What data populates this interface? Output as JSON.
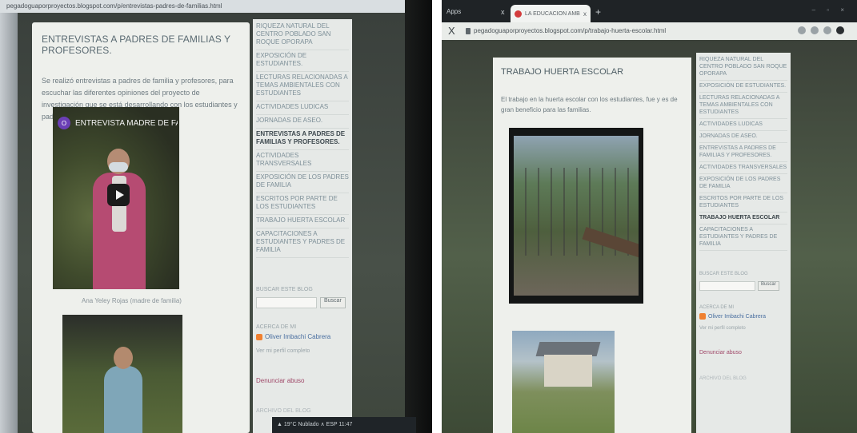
{
  "left": {
    "url": "pegadoguaporproyectos.blogspot.com/p/entrevistas-padres-de-familias.html",
    "post": {
      "title": "ENTREVISTAS A PADRES DE FAMILIAS Y PROFESORES.",
      "body": "Se realizó entrevistas a padres de familia y profesores, para escuchar las diferentes opiniones del proyecto de investigación que se está desarrollando con los estudiantes y padres de familia.",
      "video_avatar": "O",
      "video_title": "ENTREVISTA MADRE DE FA...",
      "caption": "Ana Yeley Rojas (madre de familia)"
    },
    "sidebar": {
      "nav": [
        {
          "label": "RIQUEZA NATURAL DEL CENTRO POBLADO SAN ROQUE OPORAPA",
          "active": false
        },
        {
          "label": "EXPOSICIÓN DE ESTUDIANTES.",
          "active": false
        },
        {
          "label": "LECTURAS RELACIONADAS A TEMAS AMBIENTALES CON ESTUDIANTES",
          "active": false
        },
        {
          "label": "ACTIVIDADES LUDICAS",
          "active": false
        },
        {
          "label": "JORNADAS DE ASEO.",
          "active": false
        },
        {
          "label": "ENTREVISTAS A PADRES DE FAMILIAS Y PROFESORES.",
          "active": true
        },
        {
          "label": "ACTIVIDADES TRANSVERSALES",
          "active": false
        },
        {
          "label": "EXPOSICIÓN DE LOS PADRES DE FAMILIA",
          "active": false
        },
        {
          "label": "ESCRITOS POR PARTE DE LOS ESTUDIANTES",
          "active": false
        },
        {
          "label": "TRABAJO HUERTA ESCOLAR",
          "active": false
        },
        {
          "label": "CAPACITACIONES A ESTUDIANTES Y PADRES DE FAMILIA",
          "active": false
        }
      ],
      "search_title": "BUSCAR ESTE BLOG",
      "search_button": "Buscar",
      "about_title": "ACERCA DE MI",
      "author": "Oliver Imbachi Cabrera",
      "profile_link": "Ver mi perfil completo",
      "report": "Denunciar abuso",
      "archive_title": "ARCHIVO DEL BLOG"
    },
    "taskbar": "▲ 19°C  Nublado  ∧  ESP  11:47"
  },
  "right": {
    "tabs": {
      "apps": "Apps",
      "first_close": "x",
      "active_title": "LA EDUCACIÓN AMBIENTAL, E.F.",
      "active_close": "x",
      "new_tab": "+",
      "window_controls": "–  ▫  ×"
    },
    "addr": {
      "back": "X",
      "url": "pegadoguaporproyectos.blogspot.com/p/trabajo-huerta-escolar.html"
    },
    "post": {
      "title": "TRABAJO HUERTA ESCOLAR",
      "body": "El trabajo en la huerta escolar con los estudiantes, fue y es de gran beneficio para las familias."
    },
    "sidebar": {
      "nav": [
        {
          "label": "RIQUEZA NATURAL DEL CENTRO POBLADO SAN ROQUE OPORAPA",
          "active": false
        },
        {
          "label": "EXPOSICIÓN DE ESTUDIANTES.",
          "active": false
        },
        {
          "label": "LECTURAS RELACIONADAS A TEMAS AMBIENTALES CON ESTUDIANTES",
          "active": false
        },
        {
          "label": "ACTIVIDADES LUDICAS",
          "active": false
        },
        {
          "label": "JORNADAS DE ASEO.",
          "active": false
        },
        {
          "label": "ENTREVISTAS A PADRES DE FAMILIAS Y PROFESORES.",
          "active": false
        },
        {
          "label": "ACTIVIDADES TRANSVERSALES",
          "active": false
        },
        {
          "label": "EXPOSICIÓN DE LOS PADRES DE FAMILIA",
          "active": false
        },
        {
          "label": "ESCRITOS POR PARTE DE LOS ESTUDIANTES",
          "active": false
        },
        {
          "label": "TRABAJO HUERTA ESCOLAR",
          "active": true
        },
        {
          "label": "CAPACITACIONES A ESTUDIANTES Y PADRES DE FAMILIA",
          "active": false
        }
      ],
      "search_title": "BUSCAR ESTE BLOG",
      "search_button": "Buscar",
      "about_title": "ACERCA DE MI",
      "author": "Oliver Imbachi Cabrera",
      "profile_link": "Ver mi perfil completo",
      "report": "Denunciar abuso",
      "archive_title": "ARCHIVO DEL BLOG"
    }
  },
  "colors": {
    "blog_bg": "#eef0ec",
    "sidebar_bg": "#e6e9e7",
    "nav_text": "#7d8f98",
    "author_link": "#4a6fa0",
    "report_link": "#a04a6a",
    "favicon": "#d33c3c",
    "blogger_icon": "#f08030"
  },
  "icons": {
    "play": "play-icon",
    "blogger": "blogger-icon",
    "lock": "lock-icon",
    "favicon": "blog-favicon-icon"
  }
}
